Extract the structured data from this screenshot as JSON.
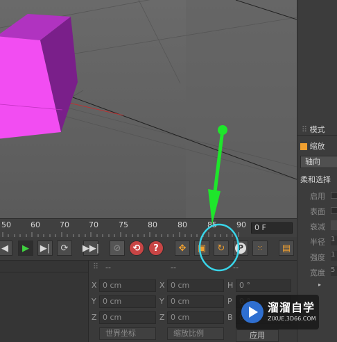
{
  "colors": {
    "arrow": "#1ee62b",
    "highlight_ellipse": "#39d4e8",
    "cube_front": "#f24df2",
    "cube_side": "#7a1f8a",
    "cube_top": "#b033c0",
    "play_green": "#3fd03f",
    "accent_orange": "#f0a030"
  },
  "timeline": {
    "ticks": [
      "50",
      "60",
      "70",
      "80",
      "85",
      "90"
    ],
    "frame_value": "0 F"
  },
  "right_panel": {
    "mode_label": "模式",
    "scale_label": "缩放",
    "axis_button": "轴向",
    "soft_selection": "柔和选择",
    "rows": [
      "启用",
      "表面",
      "衰减",
      "半径",
      "强度",
      "宽度"
    ],
    "radius_value": "1",
    "strength_value": "1",
    "width_value": "5"
  },
  "playback": {
    "icons": [
      "prev-frame-icon",
      "play-icon",
      "next-frame-icon",
      "loop-icon",
      "goto-end-icon",
      "record-disabled-icon",
      "autokey-icon",
      "help-icon",
      "move-icon",
      "scale-icon",
      "rotate-icon",
      "parameter-icon",
      "points-icon",
      "film-icon"
    ]
  },
  "coords": {
    "header_dashes": [
      "--",
      "--",
      "--"
    ],
    "position": {
      "x_label": "X",
      "y_label": "Y",
      "z_label": "Z",
      "x": "0 cm",
      "y": "0 cm",
      "z": "0 cm"
    },
    "size": {
      "x_label": "X",
      "y_label": "Y",
      "z_label": "Z",
      "x": "0 cm",
      "y": "0 cm",
      "z": "0 cm"
    },
    "rotation": {
      "h_label": "H",
      "p_label": "P",
      "b_label": "B",
      "h": "0 °",
      "p": "0 °",
      "b": "0 °"
    },
    "world_dropdown": "世界坐标",
    "scale_dropdown": "缩放比例",
    "apply_button": "应用"
  },
  "watermark": {
    "brand": "溜溜自学",
    "url": "ZIXUE.3D66.COM"
  }
}
